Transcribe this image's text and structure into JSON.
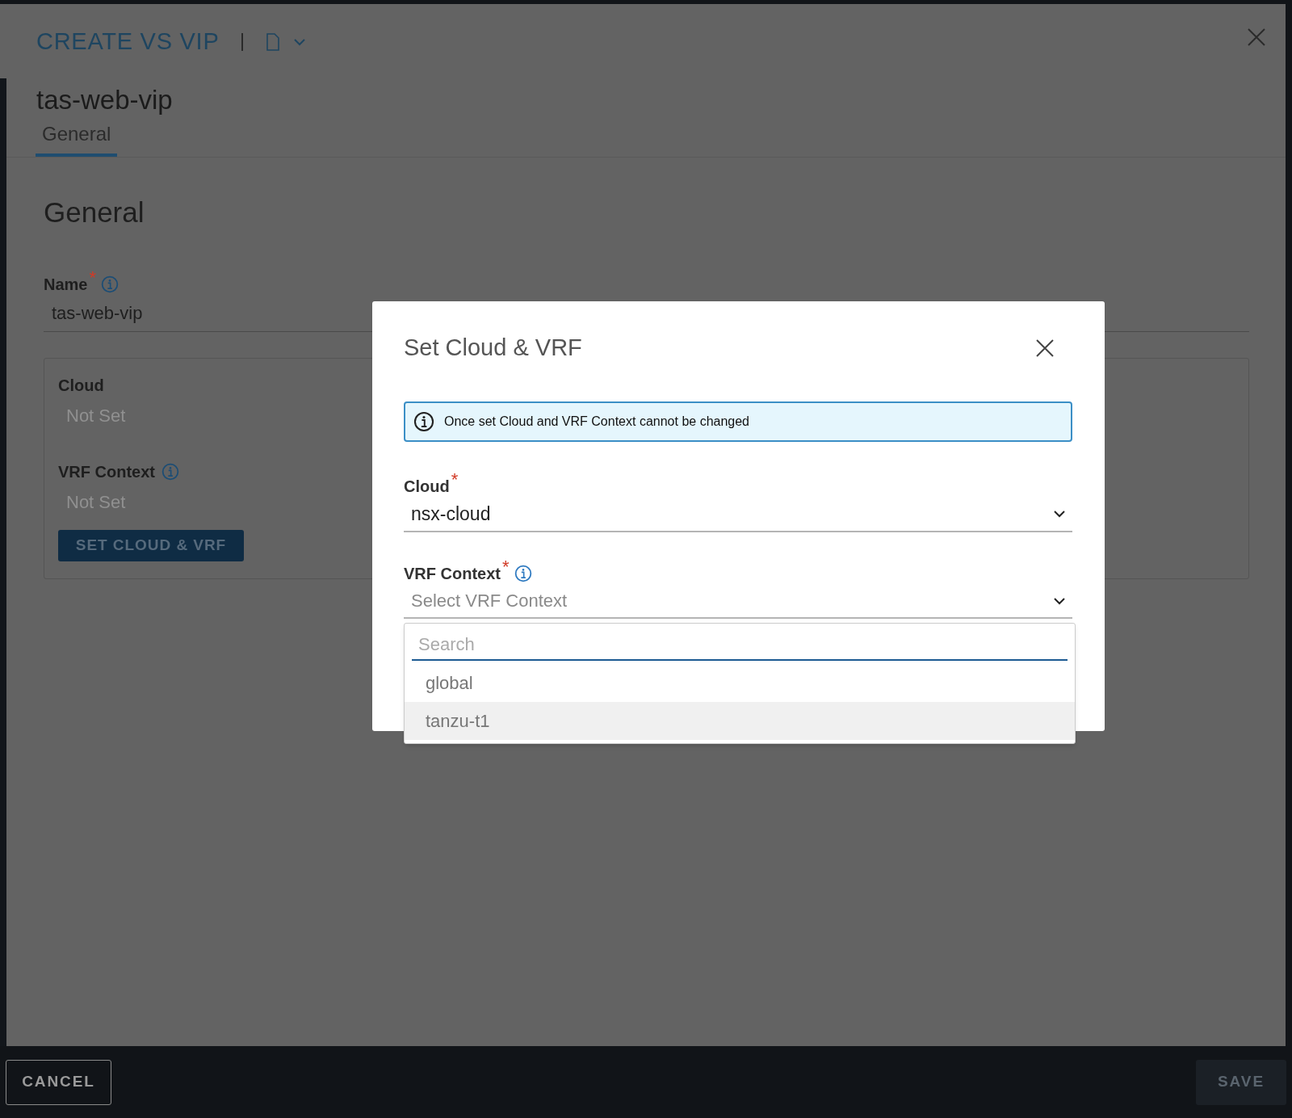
{
  "page": {
    "title": "CREATE VS VIP",
    "object_name": "tas-web-vip",
    "tabs": [
      {
        "label": "General",
        "selected": true
      }
    ],
    "section_title": "General",
    "name_field": {
      "label": "Name",
      "required_mark": "*",
      "value": "tas-web-vip"
    },
    "cloud_card": {
      "fields": [
        {
          "label": "Cloud",
          "value": "Not Set",
          "info": false
        },
        {
          "label": "VRF Context",
          "value": "Not Set",
          "info": true
        }
      ],
      "button": "SET CLOUD & VRF"
    }
  },
  "footer": {
    "buttons": [
      {
        "label": "CANCEL",
        "kind": "cancel"
      },
      {
        "label": "SAVE",
        "kind": "save",
        "disabled": true
      }
    ]
  },
  "modal": {
    "title": "Set Cloud & VRF",
    "alert": "Once set Cloud and VRF Context cannot be changed",
    "fields": [
      {
        "label": "Cloud",
        "required_mark": "*",
        "info": false,
        "value": "nsx-cloud"
      },
      {
        "label": "VRF Context",
        "required_mark": "*",
        "info": true,
        "placeholder": "Select VRF Context"
      }
    ],
    "dropdown": {
      "search_placeholder": "Search",
      "options": [
        {
          "label": "global",
          "highlighted": false
        },
        {
          "label": "tanzu-t1",
          "highlighted": true
        }
      ]
    }
  }
}
